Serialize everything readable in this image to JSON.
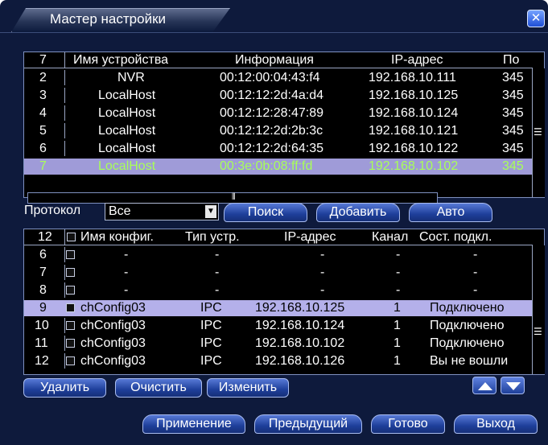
{
  "window": {
    "title": "Мастер настройки",
    "close_icon": "close-icon",
    "accent": "#1f4fd6"
  },
  "device_table": {
    "count": "7",
    "columns": [
      "Имя устройства",
      "Информация",
      "IP-адрес",
      "По"
    ],
    "rows": [
      {
        "num": "2",
        "name": "NVR",
        "info": "00:12:00:04:43:f4",
        "ip": "192.168.10.111",
        "port": "345"
      },
      {
        "num": "3",
        "name": "LocalHost",
        "info": "00:12:12:2d:4a:d4",
        "ip": "192.168.10.125",
        "port": "345"
      },
      {
        "num": "4",
        "name": "LocalHost",
        "info": "00:12:12:28:47:89",
        "ip": "192.168.10.124",
        "port": "345"
      },
      {
        "num": "5",
        "name": "LocalHost",
        "info": "00:12:12:2d:2b:3c",
        "ip": "192.168.10.121",
        "port": "345"
      },
      {
        "num": "6",
        "name": "LocalHost",
        "info": "00:12:12:2d:64:35",
        "ip": "192.168.10.122",
        "port": "345"
      },
      {
        "num": "7",
        "name": "LocalHost",
        "info": "00:3e:0b:08:ff:fd",
        "ip": "192.168.10.102",
        "port": "345"
      }
    ]
  },
  "protocol": {
    "label": "Протокол",
    "value": "Все"
  },
  "actions": {
    "search": "Поиск",
    "add": "Добавить",
    "auto": "Авто"
  },
  "config_table": {
    "count": "12",
    "columns": [
      "Имя конфиг.",
      "Тип устр.",
      "IP-адрес",
      "Канал",
      "Сост. подкл."
    ],
    "rows": [
      {
        "num": "6",
        "name": "-",
        "type": "-",
        "ip": "-",
        "channel": "-",
        "status": "-"
      },
      {
        "num": "7",
        "name": "-",
        "type": "-",
        "ip": "-",
        "channel": "-",
        "status": "-"
      },
      {
        "num": "8",
        "name": "-",
        "type": "-",
        "ip": "-",
        "channel": "-",
        "status": "-"
      },
      {
        "num": "9",
        "name": "chConfig03",
        "type": "IPC",
        "ip": "192.168.10.125",
        "channel": "1",
        "status": "Подключено"
      },
      {
        "num": "10",
        "name": "chConfig03",
        "type": "IPC",
        "ip": "192.168.10.124",
        "channel": "1",
        "status": "Подключено"
      },
      {
        "num": "11",
        "name": "chConfig03",
        "type": "IPC",
        "ip": "192.168.10.102",
        "channel": "1",
        "status": "Подключено"
      },
      {
        "num": "12",
        "name": "chConfig03",
        "type": "IPC",
        "ip": "192.168.10.126",
        "channel": "1",
        "status": "Вы не вошли"
      }
    ]
  },
  "list_actions": {
    "delete": "Удалить",
    "clear": "Очистить",
    "edit": "Изменить"
  },
  "footer": {
    "apply": "Применение",
    "previous": "Предыдущий",
    "done": "Готово",
    "exit": "Выход"
  },
  "colors": {
    "background": "#0e1a3c",
    "selected_row": "#9f9bd8",
    "selected_text": "#a8ff58"
  }
}
